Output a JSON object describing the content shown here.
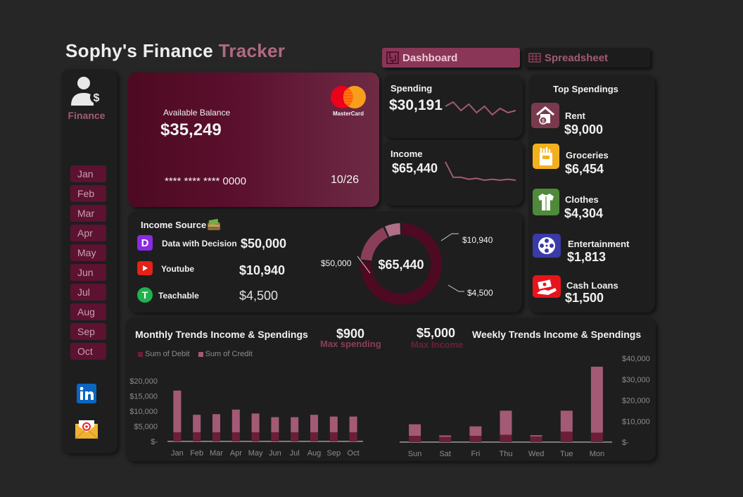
{
  "header": {
    "title_part1": "Sophy's Finance",
    "title_part2": "Tracker",
    "tabs": [
      {
        "label": "Dashboard",
        "active": true,
        "icon": "maze-icon"
      },
      {
        "label": "Spreadsheet",
        "active": false,
        "icon": "grid-icon"
      }
    ]
  },
  "sidebar": {
    "label": "Finance",
    "icon": "user-dollar-icon",
    "months": [
      "Jan",
      "Feb",
      "Mar",
      "Apr",
      "May",
      "Jun",
      "Jul",
      "Aug",
      "Sep",
      "Oct"
    ],
    "social": [
      "linkedin-icon",
      "email-icon"
    ]
  },
  "card": {
    "balance_label": "Available Balance",
    "balance_value": "$35,249",
    "card_number": "**** **** **** 0000",
    "expiry": "10/26",
    "brand": "MasterCard"
  },
  "spending": {
    "label": "Spending",
    "value": "$30,191",
    "trend": [
      14,
      16,
      12,
      15,
      11,
      14,
      10,
      13,
      11,
      12
    ]
  },
  "income": {
    "label": "Income",
    "value": "$65,440",
    "trend": [
      26,
      10,
      10,
      8,
      9,
      7,
      8,
      7,
      8,
      7
    ]
  },
  "top_spendings": {
    "title": "Top Spendings",
    "items": [
      {
        "name": "Rent",
        "value": "$9,000",
        "icon": "house-money-icon",
        "color": "#7a3a4e"
      },
      {
        "name": "Groceries",
        "value": "$6,454",
        "icon": "groceries-icon",
        "color": "#f2b01e"
      },
      {
        "name": "Clothes",
        "value": "$4,304",
        "icon": "shirt-icon",
        "color": "#4f8a3a"
      },
      {
        "name": "Entertainment",
        "value": "$1,813",
        "icon": "film-reel-icon",
        "color": "#3a3aa8"
      },
      {
        "name": "Cash Loans",
        "value": "$1,500",
        "icon": "cash-hand-icon",
        "color": "#e8141c"
      }
    ]
  },
  "income_source": {
    "title": "Income Source",
    "items": [
      {
        "name": "Data with Decision",
        "value": "$50,000",
        "icon": "d-logo-icon",
        "color": "#8a2be2"
      },
      {
        "name": "Youtube",
        "value": "$10,940",
        "icon": "youtube-icon",
        "color": "#e62117"
      },
      {
        "name": "Teachable",
        "value": "$4,500",
        "icon": "teachable-icon",
        "color": "#1eb34f"
      }
    ],
    "donut_center": "$65,440",
    "donut_labels": [
      "$50,000",
      "$10,940",
      "$4,500"
    ],
    "donut_values": [
      50000,
      10940,
      4500
    ]
  },
  "bottom": {
    "monthly_title": "Monthly Trends Income & Spendings",
    "weekly_title": "Weekly Trends Income & Spendings",
    "max_spending_value": "$900",
    "max_spending_label": "Max spending",
    "max_income_value": "$5,000",
    "max_income_label": "Max Income",
    "legend_debit": "Sum of Debit",
    "legend_credit": "Sum of Credit"
  },
  "colors": {
    "accent": "#6b1e3a",
    "accent_light": "#a35a75",
    "background": "#262626",
    "panel": "#1e1e1e"
  },
  "chart_data": [
    {
      "type": "bar",
      "title": "Monthly Trends Income & Spendings",
      "categories": [
        "Jan",
        "Feb",
        "Mar",
        "Apr",
        "May",
        "Jun",
        "Jul",
        "Aug",
        "Sep",
        "Oct"
      ],
      "series": [
        {
          "name": "Sum of Debit",
          "values": [
            3000,
            3000,
            3000,
            3000,
            3000,
            3000,
            3000,
            3000,
            3000,
            3000
          ]
        },
        {
          "name": "Sum of Credit",
          "values": [
            13800,
            5800,
            6000,
            7500,
            6200,
            5000,
            5000,
            5800,
            5200,
            5200
          ]
        }
      ],
      "y_ticks": [
        "$-",
        "$5,000",
        "$10,000",
        "$15,000",
        "$20,000"
      ],
      "ylim": [
        0,
        20000
      ],
      "stacked": true,
      "legend": "top-left"
    },
    {
      "type": "bar",
      "title": "Weekly Trends Income & Spendings",
      "categories": [
        "Sun",
        "Sat",
        "Fri",
        "Thu",
        "Wed",
        "Tue",
        "Mon"
      ],
      "series": [
        {
          "name": "Sum of Debit",
          "values": [
            3000,
            2500,
            3000,
            3500,
            2700,
            5000,
            4500
          ]
        },
        {
          "name": "Sum of Credit",
          "values": [
            5500,
            700,
            4500,
            11500,
            600,
            10000,
            31500
          ]
        }
      ],
      "y_ticks": [
        "$-",
        "$10,000",
        "$20,000",
        "$30,000",
        "$40,000"
      ],
      "ylim": [
        0,
        40000
      ],
      "stacked": true
    }
  ]
}
